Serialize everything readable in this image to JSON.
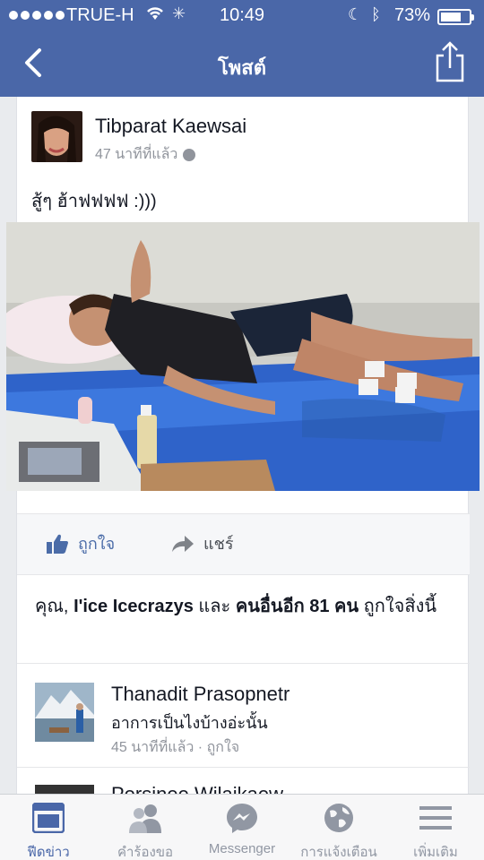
{
  "status_bar": {
    "carrier": "TRUE-H",
    "time": "10:49",
    "battery_percent": "73%",
    "battery_level": 0.73
  },
  "nav": {
    "title": "โพสต์"
  },
  "post": {
    "author": "Tibparat Kaewsai",
    "time_ago": "47 นาทีที่แล้ว",
    "text": "สู้ๆ ฮ้าฟฟฟฟ :)))"
  },
  "actions": {
    "like_label": "ถูกใจ",
    "share_label": "แชร์"
  },
  "likes": {
    "prefix": "คุณ,",
    "name": "I'ice Icecrazys",
    "and": "และ",
    "others": "คนอื่นอีก 81 คน",
    "suffix": "ถูกใจสิ่งนี้"
  },
  "comments": [
    {
      "name": "Thanadit Prasopnetr",
      "text": "อาการเป็นไงบ้างอ่ะนั้น",
      "meta": "45 นาทีที่แล้ว · ถูกใจ"
    },
    {
      "name": "Porsinee Wilaikaew"
    }
  ],
  "tabbar": {
    "tabs": [
      {
        "label": "ฟีดข่าว",
        "icon": "news-feed-icon"
      },
      {
        "label": "คำร้องขอ",
        "icon": "friend-requests-icon"
      },
      {
        "label": "Messenger",
        "icon": "messenger-icon"
      },
      {
        "label": "การแจ้งเตือน",
        "icon": "globe-notifications-icon"
      },
      {
        "label": "เพิ่มเติม",
        "icon": "menu-icon"
      }
    ]
  },
  "colors": {
    "brand_blue": "#4a67a8",
    "tab_inactive": "#9197a3"
  }
}
